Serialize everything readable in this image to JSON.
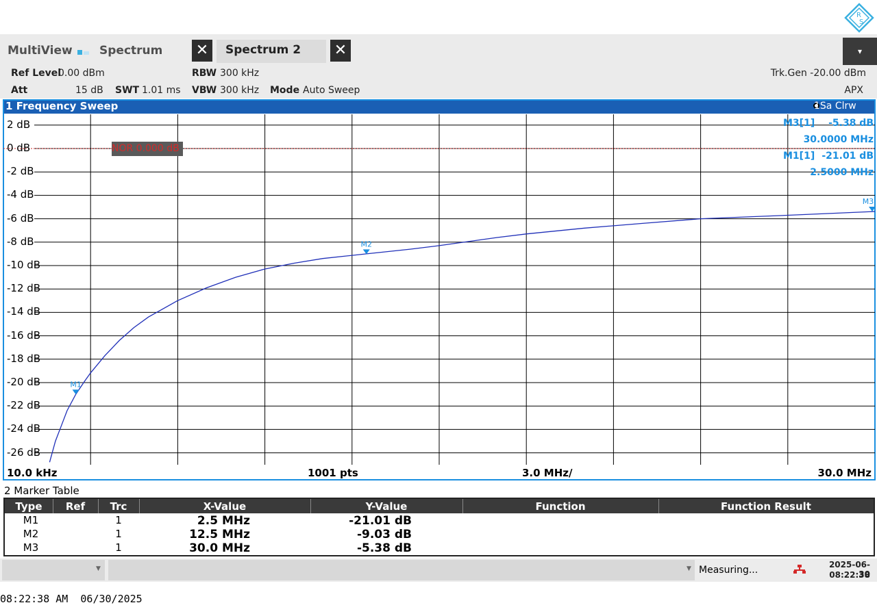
{
  "window": {
    "tabs": [
      {
        "label": "MultiView"
      },
      {
        "label": "Spectrum"
      },
      {
        "label": "Spectrum 2",
        "active": true
      }
    ],
    "close_glyph": "✕",
    "menu_glyph": "▾"
  },
  "settings": {
    "ref_level_label": "Ref Level",
    "ref_level_value": "0.00 dBm",
    "att_label": "Att",
    "att_value": "15 dB",
    "swt_label": "SWT",
    "swt_value": "1.01 ms",
    "rbw_label": "RBW",
    "rbw_value": "300 kHz",
    "vbw_label": "VBW",
    "vbw_value": "300 kHz",
    "mode_label": "Mode",
    "mode_value": "Auto Sweep",
    "trk_gen": "Trk.Gen -20.00 dBm",
    "apx": "APX"
  },
  "diagram": {
    "title": "1 Frequency Sweep",
    "trace_info": "1Sa Clrw",
    "nor_label": "NOR 0.000 dB",
    "footer_left": "10.0 kHz",
    "footer_center": "1001 pts",
    "footer_span": "3.0 MHz/",
    "footer_right": "30.0 MHz",
    "marker_info": [
      {
        "label": "M3[1]",
        "value": "-5.38 dB",
        "freq": "30.0000 MHz"
      },
      {
        "label": "M1[1]",
        "value": "-21.01 dB",
        "freq": "2.5000 MHz"
      }
    ]
  },
  "chart_data": {
    "type": "line",
    "title": "1 Frequency Sweep",
    "xlabel": "",
    "ylabel": "",
    "x_unit": "MHz",
    "y_unit": "dB",
    "xlim": [
      0.01,
      30.0
    ],
    "ylim": [
      -27,
      3
    ],
    "y_ticks": [
      "2 dB",
      "0 dB",
      "-2 dB",
      "-4 dB",
      "-6 dB",
      "-8 dB",
      "-10 dB",
      "-12 dB",
      "-14 dB",
      "-16 dB",
      "-18 dB",
      "-20 dB",
      "-22 dB",
      "-24 dB",
      "-26 dB"
    ],
    "grid": true,
    "series": [
      {
        "color": "#1f2fb8",
        "x": [
          1.6,
          1.8,
          2.0,
          2.2,
          2.5,
          2.8,
          3.0,
          3.5,
          4.0,
          4.5,
          5.0,
          6.0,
          7.0,
          8.0,
          9.0,
          10.0,
          11.0,
          12.5,
          14.0,
          15.0,
          17.0,
          18.0,
          20.0,
          22.0,
          24.0,
          27.0,
          30.0
        ],
        "y": [
          -26.8,
          -25.0,
          -23.7,
          -22.4,
          -21.0,
          -19.9,
          -19.2,
          -17.7,
          -16.4,
          -15.3,
          -14.4,
          -13.0,
          -11.9,
          -11.0,
          -10.3,
          -9.8,
          -9.4,
          -9.0,
          -8.6,
          -8.3,
          -7.6,
          -7.3,
          -6.8,
          -6.4,
          -6.0,
          -5.7,
          -5.38
        ]
      }
    ],
    "markers": [
      {
        "name": "M1",
        "x": 2.5,
        "y": -21.01
      },
      {
        "name": "M2",
        "x": 12.5,
        "y": -9.03
      },
      {
        "name": "M3",
        "x": 30.0,
        "y": -5.38
      }
    ],
    "reference_line": {
      "y": 0,
      "color": "#cc2a2a"
    }
  },
  "marker_table": {
    "title": "2 Marker Table",
    "headers": [
      "Type",
      "Ref",
      "Trc",
      "X-Value",
      "Y-Value",
      "Function",
      "Function Result"
    ],
    "rows": [
      {
        "type": "M1",
        "ref": "",
        "trc": "1",
        "x": "2.5 MHz",
        "y": "-21.01 dB"
      },
      {
        "type": "M2",
        "ref": "",
        "trc": "1",
        "x": "12.5 MHz",
        "y": "-9.03 dB"
      },
      {
        "type": "M3",
        "ref": "",
        "trc": "1",
        "x": "30.0 MHz",
        "y": "-5.38 dB"
      }
    ]
  },
  "status": {
    "text": "Measuring...",
    "date": "2025-06-30",
    "time": "08:22:38"
  },
  "timestamp": "08:22:38 AM  06/30/2025"
}
